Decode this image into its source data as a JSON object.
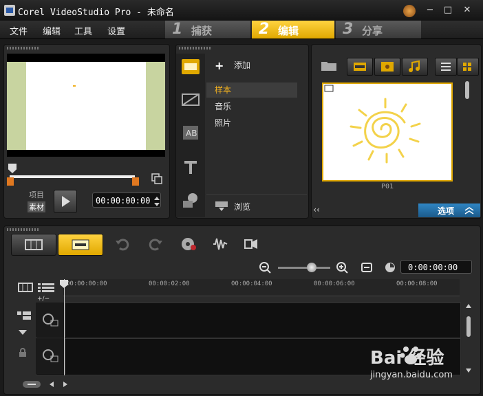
{
  "window": {
    "title": "Corel VideoStudio Pro - 未命名",
    "minimize": "−",
    "maximize": "□",
    "close": "✕"
  },
  "menu": [
    "文件",
    "编辑",
    "工具",
    "设置"
  ],
  "steps": [
    {
      "num": "1",
      "label": "捕获"
    },
    {
      "num": "2",
      "label": "编辑"
    },
    {
      "num": "3",
      "label": "分享"
    }
  ],
  "preview": {
    "project_label": "项目",
    "clip_label": "素材",
    "timecode": "00:00:00:00"
  },
  "library": {
    "add_label": "添加",
    "items": [
      "样本",
      "音乐",
      "照片"
    ],
    "browse_label": "浏览"
  },
  "media": {
    "thumb_label": "P01",
    "options_label": "选项"
  },
  "timeline": {
    "project_timecode": "0:00:00:00",
    "ticks": [
      "00:00:00:00",
      "00:00:02:00",
      "00:00:04:00",
      "00:00:06:00",
      "00:00:08:00"
    ],
    "add_track": "+/−"
  },
  "watermark": {
    "brand": "Bai  经验",
    "url": "jingyan.baidu.com"
  },
  "colors": {
    "accent": "#e0a800",
    "options_tab": "#1c5a8a"
  }
}
